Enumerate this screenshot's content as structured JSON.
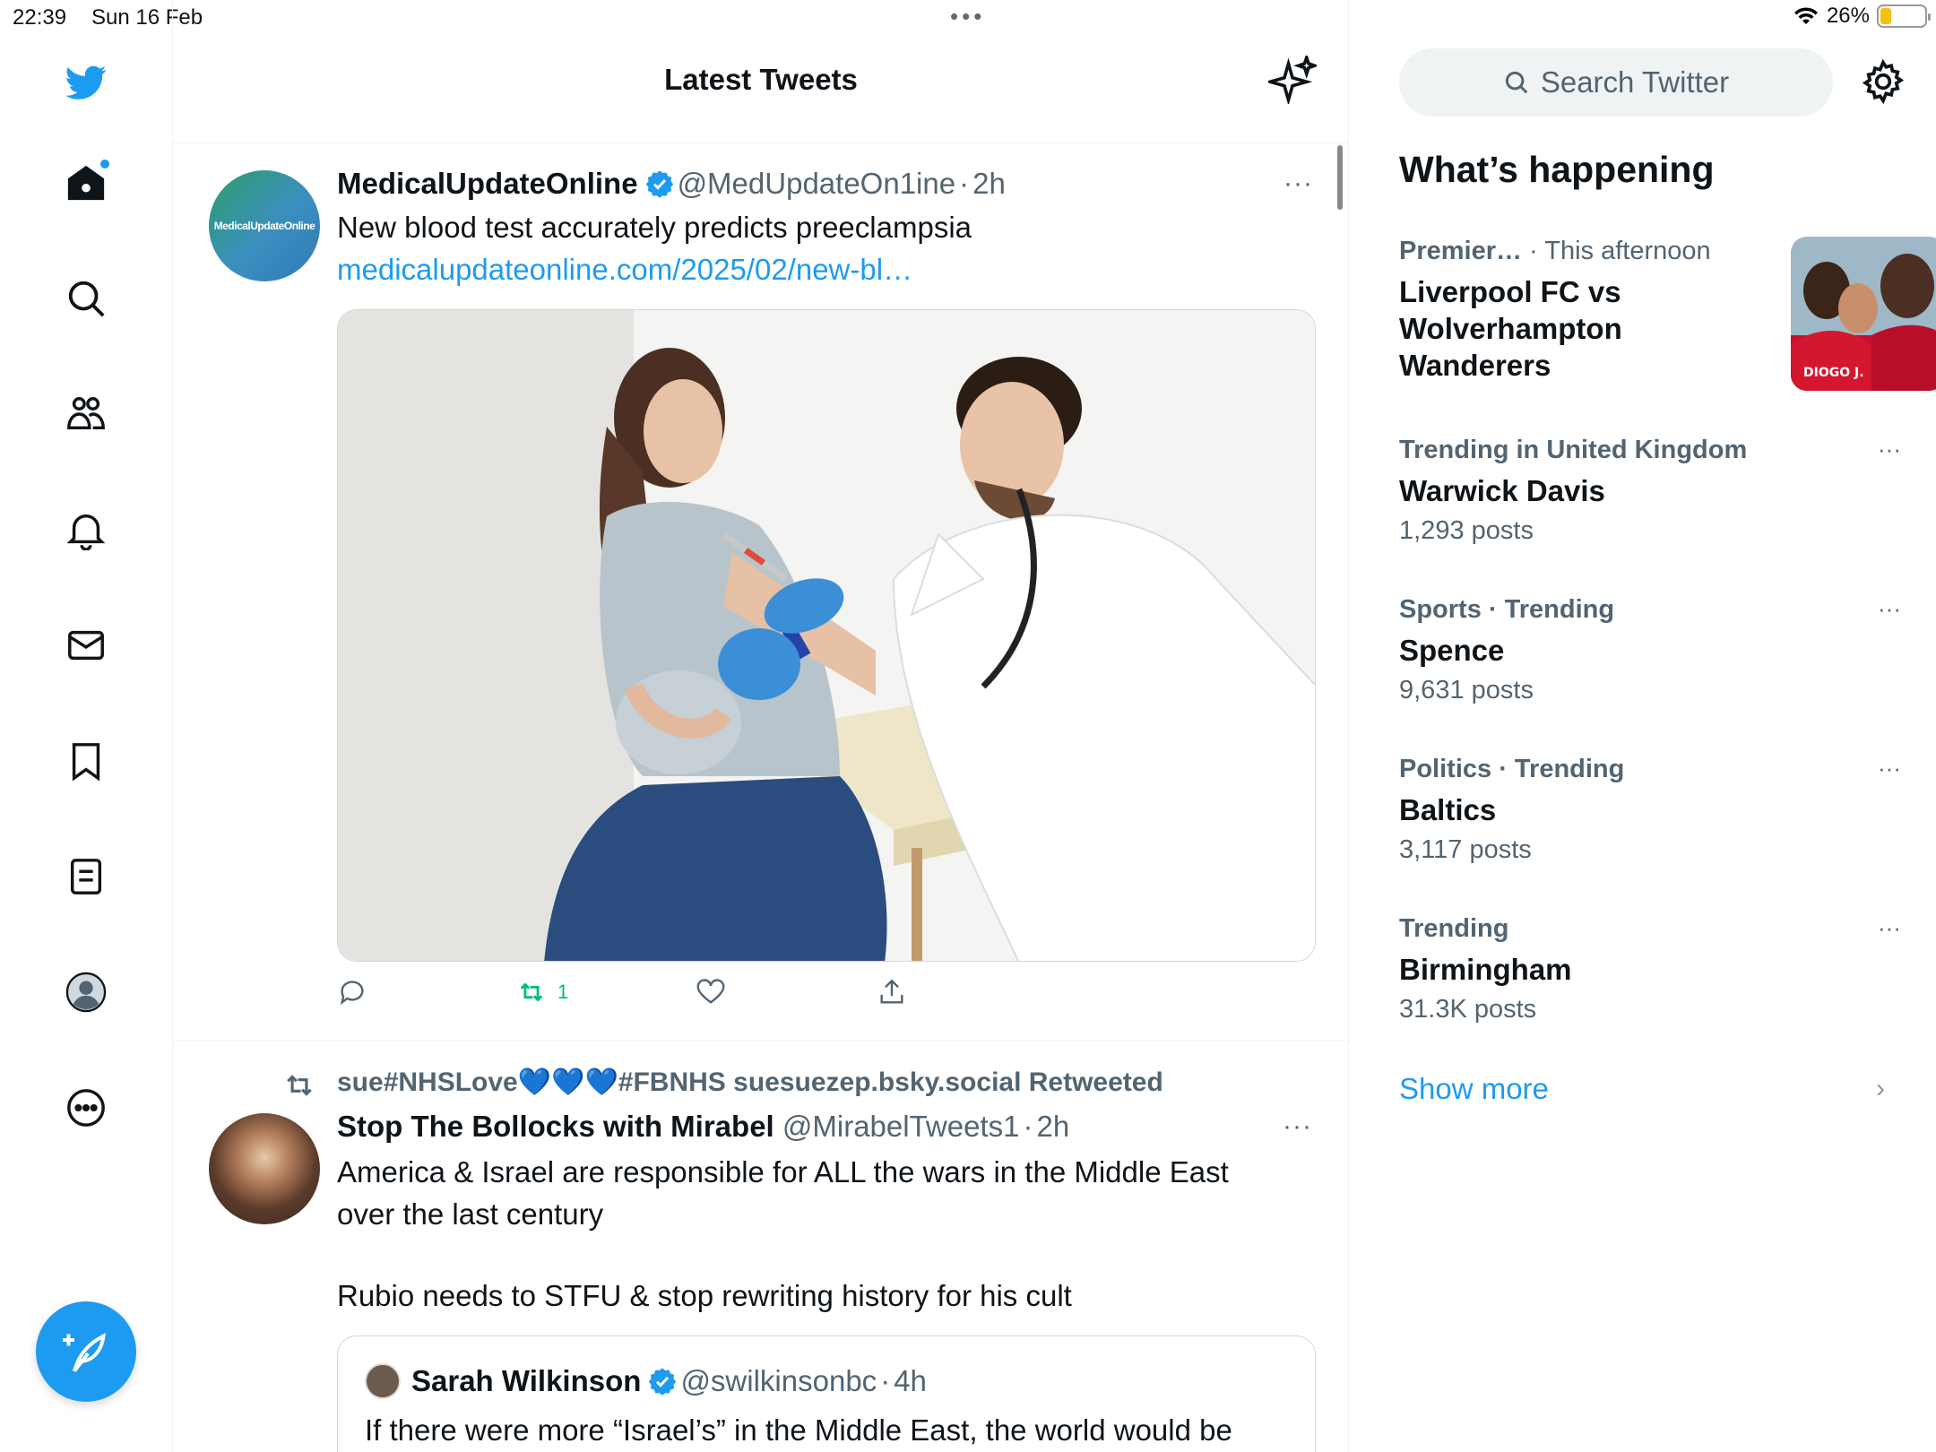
{
  "status_bar": {
    "time": "22:39",
    "date": "Sun 16 Feb",
    "battery_percent": "26%",
    "battery_level": 0.26,
    "multitask_dots": "•••"
  },
  "colors": {
    "accent": "#1d9bf0",
    "retweet_green": "#00ba7c",
    "secondary_text": "#536471"
  },
  "nav": {
    "items": [
      "twitter-logo",
      "home-icon",
      "search-icon",
      "communities-icon",
      "notifications-icon",
      "messages-icon",
      "bookmarks-icon",
      "lists-icon",
      "profile-icon",
      "more-icon"
    ]
  },
  "header": {
    "title": "Latest Tweets"
  },
  "tweets": [
    {
      "avatar_text": "MedicalUpdateOnline",
      "name": "MedicalUpdateOnline",
      "handle": "@MedUpdateOn1ine",
      "dot": "·",
      "time": "2h",
      "more": "···",
      "text": "New blood test accurately predicts preeclampsia",
      "link": "medicalupdateonline.com/2025/02/new-bl…",
      "retweet_count": "1"
    },
    {
      "retweeted_by": "sue#NHSLove💙💙💙#FBNHS suesuezep.bsky.social Retweeted",
      "name": "Stop The Bollocks with Mirabel",
      "handle": "@MirabelTweets1",
      "dot": "·",
      "time": "2h",
      "more": "···",
      "text_line1": "America & Israel are responsible for ALL the wars in the Middle East",
      "text_line2": "over the last century",
      "text_line3": "Rubio needs to STFU & stop rewriting history for his cult",
      "quote": {
        "name": "Sarah Wilkinson",
        "handle": "@swilkinsonbc",
        "dot": "·",
        "time": "4h",
        "text": "If there were more “Israel’s” in the Middle East, the world would be"
      }
    }
  ],
  "sidebar": {
    "search_placeholder": "Search Twitter",
    "whats_happening": "What’s happening",
    "trends": [
      {
        "meta": "Premier…",
        "meta_light": " · This afternoon",
        "title": "Liverpool FC vs Wolverhampton Wanderers",
        "image_text": "DIOGO J."
      },
      {
        "meta": "Trending in United Kingdom",
        "title": "Warwick Davis",
        "count": "1,293 posts",
        "more": "···"
      },
      {
        "meta": "Sports · Trending",
        "title": "Spence",
        "count": "9,631 posts",
        "more": "···"
      },
      {
        "meta": "Politics · Trending",
        "title": "Baltics",
        "count": "3,117 posts",
        "more": "···"
      },
      {
        "meta": "Trending",
        "title": "Birmingham",
        "count": "31.3K posts",
        "more": "···"
      }
    ],
    "show_more": "Show more",
    "chevron": "›"
  }
}
